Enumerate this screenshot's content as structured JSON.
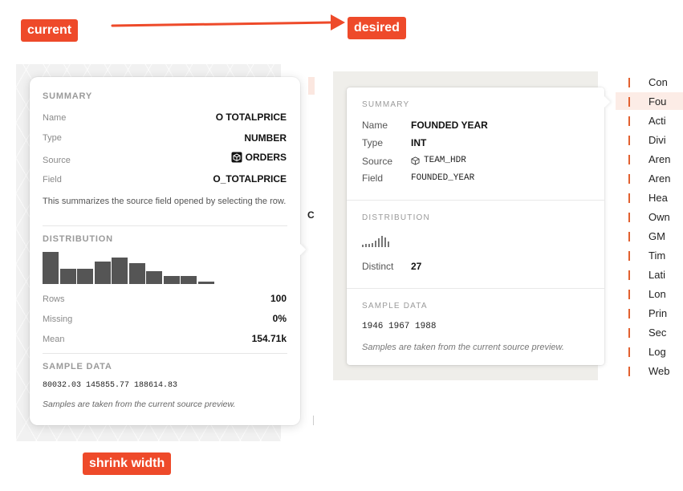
{
  "annotations": {
    "current": "current",
    "desired": "desired",
    "shrink_width": "shrink width"
  },
  "colors": {
    "annotation": "#ee4a2a",
    "accent_mark": "#e2602f",
    "bar": "#555555"
  },
  "current_panel": {
    "summary_heading": "SUMMARY",
    "name_label": "Name",
    "name_value": "O TOTALPRICE",
    "type_label": "Type",
    "type_value": "NUMBER",
    "source_label": "Source",
    "source_value": "ORDERS",
    "source_icon": "cube-icon",
    "field_label": "Field",
    "field_value": "O_TOTALPRICE",
    "description": "This summarizes the source field opened by selecting the row.",
    "distribution_heading": "DISTRIBUTION",
    "histogram": [
      100,
      48,
      48,
      70,
      82,
      66,
      40,
      26,
      24,
      8
    ],
    "rows_label": "Rows",
    "rows_value": "100",
    "missing_label": "Missing",
    "missing_value": "0%",
    "mean_label": "Mean",
    "mean_value": "154.71k",
    "sample_heading": "SAMPLE DATA",
    "samples": "80032.03 145855.77 188614.83",
    "note": "Samples are taken from the current source preview."
  },
  "left_edge_text": "C",
  "desired_panel": {
    "summary_heading": "SUMMARY",
    "name_label": "Name",
    "name_value": "FOUNDED YEAR",
    "type_label": "Type",
    "type_value": "INT",
    "source_label": "Source",
    "source_value": "TEAM_HDR",
    "source_icon": "cube-icon",
    "field_label": "Field",
    "field_value": "FOUNDED_YEAR",
    "distribution_heading": "DISTRIBUTION",
    "sparkline": [
      20,
      25,
      30,
      38,
      55,
      78,
      100,
      88,
      50
    ],
    "distinct_label": "Distinct",
    "distinct_value": "27",
    "sample_heading": "SAMPLE DATA",
    "samples": "1946 1967 1988",
    "note": "Samples are taken from the current source preview."
  },
  "field_list": [
    "Con",
    "Fou",
    "Acti",
    "Divi",
    "Aren",
    "Aren",
    "Hea",
    "Own",
    "GM",
    "Tim",
    "Lati",
    "Lon",
    "Prin",
    "Sec",
    "Log",
    "Web"
  ]
}
